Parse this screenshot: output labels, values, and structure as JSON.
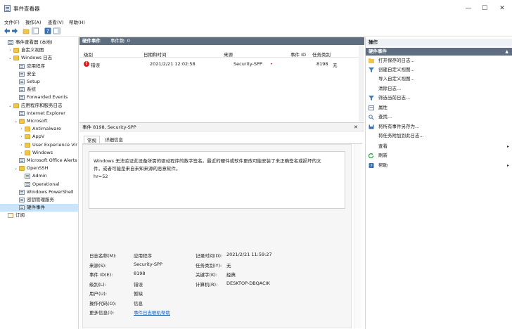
{
  "window": {
    "title": "事件查看器",
    "minimize": "—",
    "maximize": "☐",
    "close": "✕"
  },
  "menu": [
    "文件(F)",
    "操作(A)",
    "查看(V)",
    "帮助(H)"
  ],
  "tree": [
    {
      "label": "事件查看器 (本地)",
      "indent": 0,
      "twisty": "",
      "icon": "log"
    },
    {
      "label": "自定义视图",
      "indent": 1,
      "twisty": "›",
      "icon": "folder"
    },
    {
      "label": "Windows 日志",
      "indent": 1,
      "twisty": "⌄",
      "icon": "folder"
    },
    {
      "label": "应用程序",
      "indent": 2,
      "twisty": "",
      "icon": "log"
    },
    {
      "label": "安全",
      "indent": 2,
      "twisty": "",
      "icon": "log"
    },
    {
      "label": "Setup",
      "indent": 2,
      "twisty": "",
      "icon": "log"
    },
    {
      "label": "系统",
      "indent": 2,
      "twisty": "",
      "icon": "log"
    },
    {
      "label": "Forwarded Events",
      "indent": 2,
      "twisty": "",
      "icon": "log"
    },
    {
      "label": "应用程序和服务日志",
      "indent": 1,
      "twisty": "⌄",
      "icon": "folder"
    },
    {
      "label": "Internet Explorer",
      "indent": 2,
      "twisty": "",
      "icon": "log"
    },
    {
      "label": "Microsoft",
      "indent": 2,
      "twisty": "⌄",
      "icon": "folder"
    },
    {
      "label": "Antimalware",
      "indent": 3,
      "twisty": "›",
      "icon": "folder"
    },
    {
      "label": "AppV",
      "indent": 3,
      "twisty": "›",
      "icon": "folder"
    },
    {
      "label": "User Experience Vir",
      "indent": 3,
      "twisty": "›",
      "icon": "folder"
    },
    {
      "label": "Windows",
      "indent": 3,
      "twisty": "›",
      "icon": "folder"
    },
    {
      "label": "Microsoft Office Alerts",
      "indent": 2,
      "twisty": "",
      "icon": "log"
    },
    {
      "label": "OpenSSH",
      "indent": 2,
      "twisty": "⌄",
      "icon": "folder"
    },
    {
      "label": "Admin",
      "indent": 3,
      "twisty": "",
      "icon": "log"
    },
    {
      "label": "Operational",
      "indent": 3,
      "twisty": "",
      "icon": "log"
    },
    {
      "label": "Windows PowerShell",
      "indent": 2,
      "twisty": "",
      "icon": "log"
    },
    {
      "label": "密钥管理服务",
      "indent": 2,
      "twisty": "",
      "icon": "log"
    },
    {
      "label": "硬件事件",
      "indent": 2,
      "twisty": "",
      "icon": "log",
      "selected": true
    },
    {
      "label": "订阅",
      "indent": 0,
      "twisty": "",
      "icon": "sub"
    }
  ],
  "eventlist": {
    "tab_title": "硬件事件",
    "count_text": "事件数: 0",
    "columns": [
      "级别",
      "日期和时间",
      "来源",
      "事件 ID",
      "任务类别"
    ],
    "row": {
      "level": "错误",
      "datetime": "2021/2/21 12:02:58",
      "source": "Security-SPP",
      "marker": "•",
      "event_id": "8198",
      "task": "无"
    }
  },
  "detail": {
    "title": "事件 8198, Security-SPP",
    "close": "✕",
    "tabs": [
      "常规",
      "详细信息"
    ],
    "message_lines": [
      "Windows 无法验证此设备所需的驱动程序的数字签名。最近的硬件或软件更改可能安装了未正确签名或损坏的文",
      "件，或者可能是来自未知来源的恶意软件。",
      "hr=52"
    ],
    "props_left": [
      {
        "k": "日志名称(M):",
        "v": "应用程序"
      },
      {
        "k": "来源(S):",
        "v": "Security-SPP"
      },
      {
        "k": "事件 ID(E):",
        "v": "8198"
      },
      {
        "k": "级别(L):",
        "v": "错误"
      },
      {
        "k": "用户(U):",
        "v": "暂缺"
      },
      {
        "k": "操作代码(O):",
        "v": "信息"
      },
      {
        "k": "更多信息(I):",
        "v": "事件日志联机帮助"
      }
    ],
    "props_right": [
      {
        "k": "记录时间(D):",
        "v": "2021/2/21 11:59:27"
      },
      {
        "k": "任务类别(Y):",
        "v": "无"
      },
      {
        "k": "关键字(K):",
        "v": "经典"
      },
      {
        "k": "计算机(R):",
        "v": "DESKTOP-DBQACIK"
      }
    ]
  },
  "actions": {
    "header": "操作",
    "section1": "硬件事件",
    "section1_items": [
      {
        "label": "打开保存的日志...",
        "icon": "open",
        "arrow": ""
      },
      {
        "label": "创建自定义视图...",
        "icon": "filter",
        "arrow": ""
      },
      {
        "label": "导入自定义视图...",
        "icon": "",
        "arrow": ""
      },
      {
        "label": "清除日志...",
        "icon": "",
        "arrow": ""
      },
      {
        "label": "筛选当前日志...",
        "icon": "filter",
        "arrow": ""
      },
      {
        "label": "属性",
        "icon": "props",
        "arrow": ""
      },
      {
        "label": "查找...",
        "icon": "find",
        "arrow": ""
      },
      {
        "label": "将所有事件另存为...",
        "icon": "save",
        "arrow": ""
      },
      {
        "label": "将任务附加到此日志...",
        "icon": "",
        "arrow": ""
      },
      {
        "label": "查看",
        "icon": "",
        "arrow": "▸"
      },
      {
        "label": "刷新",
        "icon": "refresh",
        "arrow": ""
      },
      {
        "label": "帮助",
        "icon": "help",
        "arrow": "▸"
      }
    ],
    "collapse": "▲"
  }
}
